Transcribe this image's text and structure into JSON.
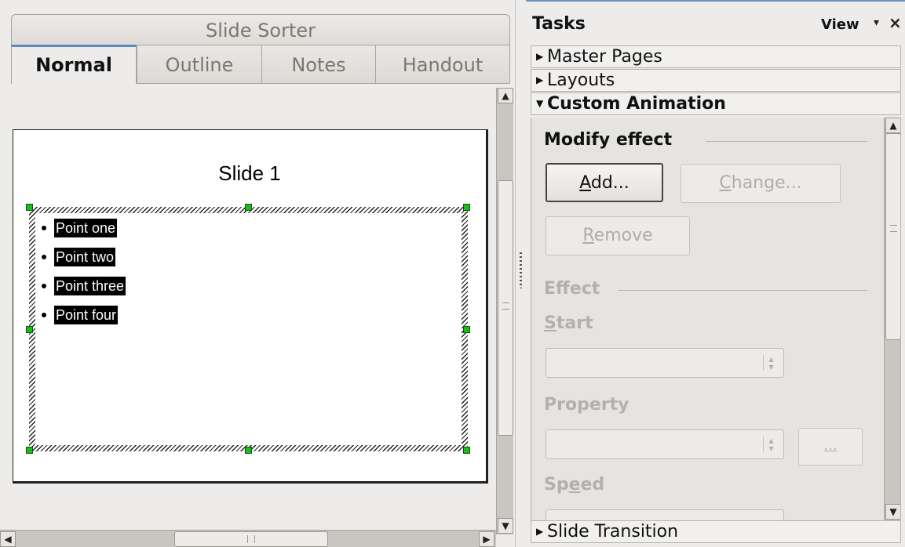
{
  "left": {
    "sorter_tab": "Slide Sorter",
    "tabs": [
      "Normal",
      "Outline",
      "Notes",
      "Handout"
    ],
    "slide": {
      "title": "Slide 1",
      "bullets": [
        "Point one",
        "Point two",
        "Point three",
        "Point four"
      ]
    }
  },
  "right": {
    "title": "Tasks",
    "view_label": "View",
    "view_arrow": "▾",
    "close": "×",
    "panels": {
      "master_pages": "Master Pages",
      "layouts": "Layouts",
      "custom_animation": "Custom Animation",
      "slide_transition": "Slide Transition"
    },
    "custom_animation": {
      "modify_effect": "Modify effect",
      "add_button": {
        "accel": "A",
        "rest": "dd..."
      },
      "change_button": {
        "accel": "C",
        "rest": "hange..."
      },
      "remove_button": {
        "accel": "R",
        "rest": "emove"
      },
      "effect_label": "Effect",
      "start_label": {
        "accel": "S",
        "rest": "tart"
      },
      "property_label": "Property",
      "more_button": "...",
      "speed_label": {
        "pre": "Sp",
        "accel": "e",
        "rest": "ed"
      }
    }
  }
}
